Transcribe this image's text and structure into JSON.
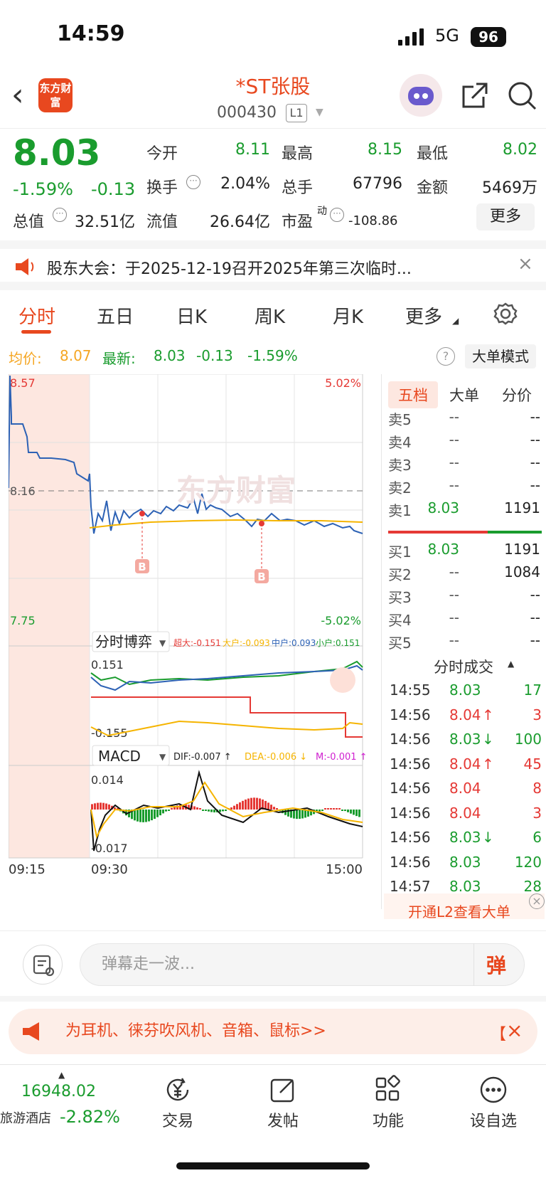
{
  "status": {
    "time": "14:59",
    "network": "5G",
    "battery": "96"
  },
  "header": {
    "title": "*ST张股",
    "code": "000430",
    "level": "L1",
    "logo": "东方财富"
  },
  "quote": {
    "price": "8.03",
    "change_pct": "-1.59%",
    "change": "-0.13",
    "open_label": "今开",
    "open": "8.11",
    "high_label": "最高",
    "high": "8.15",
    "low_label": "最低",
    "low": "8.02",
    "turnover_label": "换手",
    "turnover": "2.04%",
    "volume_label": "总手",
    "volume": "67796",
    "amount_label": "金额",
    "amount": "5469万",
    "mktcap_label": "总值",
    "mktcap": "32.51亿",
    "float_label": "流值",
    "float": "26.64亿",
    "pe_label": "市盈",
    "pe_sup": "动",
    "pe": "-108.86",
    "more": "更多"
  },
  "notice": {
    "text": "股东大会：于2025-12-19召开2025年第三次临时..."
  },
  "tabs": [
    "分时",
    "五日",
    "日K",
    "周K",
    "月K",
    "更多"
  ],
  "avgbar": {
    "avg_label": "均价:",
    "avg": "8.07",
    "latest_label": "最新:",
    "latest": "8.03",
    "chg": "-0.13",
    "pct": "-1.59%",
    "bigorder": "大单模式"
  },
  "chart_data": {
    "type": "line",
    "price_axis": {
      "max": "8.57",
      "ref": "8.16",
      "min": "7.75",
      "max_pct": "5.02%",
      "min_pct": "-5.02%"
    },
    "time_labels": [
      "09:15",
      "09:30",
      "15:00"
    ],
    "markers": [
      "B",
      "B"
    ],
    "sub1": {
      "name": "分时博弈",
      "legend": [
        {
          "label": "超大:-0.151",
          "color": "#e53935"
        },
        {
          "label": "大户:-0.093",
          "color": "#f5b400"
        },
        {
          "label": "中户:0.093",
          "color": "#2d62b5"
        },
        {
          "label": "小户:0.151",
          "color": "#1a9c2e"
        }
      ],
      "top": "0.151",
      "bottom": "-0.155"
    },
    "sub2": {
      "name": "MACD",
      "legend": [
        {
          "label": "DIF:-0.007 ↑",
          "color": "#222"
        },
        {
          "label": "DEA:-0.006 ↓",
          "color": "#f5b400"
        },
        {
          "label": "M:-0.001 ↑",
          "color": "#d020d0"
        }
      ],
      "top": "0.014",
      "bottom": "-0.017"
    }
  },
  "orderbook": {
    "tabs": [
      "五档",
      "大单",
      "分价"
    ],
    "asks": [
      {
        "label": "卖5",
        "price": "--",
        "vol": "--"
      },
      {
        "label": "卖4",
        "price": "--",
        "vol": "--"
      },
      {
        "label": "卖3",
        "price": "--",
        "vol": "--"
      },
      {
        "label": "卖2",
        "price": "--",
        "vol": "--"
      },
      {
        "label": "卖1",
        "price": "8.03",
        "vol": "1191"
      }
    ],
    "bids": [
      {
        "label": "买1",
        "price": "8.03",
        "vol": "1191"
      },
      {
        "label": "买2",
        "price": "--",
        "vol": "1084"
      },
      {
        "label": "买3",
        "price": "--",
        "vol": "--"
      },
      {
        "label": "买4",
        "price": "--",
        "vol": "--"
      },
      {
        "label": "买5",
        "price": "--",
        "vol": "--"
      }
    ],
    "trades_title": "分时成交",
    "trades": [
      {
        "time": "14:55",
        "price": "8.03",
        "arrow": "",
        "vol": "17",
        "vc": "green"
      },
      {
        "time": "14:56",
        "price": "8.04",
        "arrow": "↑",
        "vol": "3",
        "vc": "red"
      },
      {
        "time": "14:56",
        "price": "8.03",
        "arrow": "↓",
        "vol": "100",
        "vc": "green"
      },
      {
        "time": "14:56",
        "price": "8.04",
        "arrow": "↑",
        "vol": "45",
        "vc": "red"
      },
      {
        "time": "14:56",
        "price": "8.04",
        "arrow": "",
        "vol": "8",
        "vc": "red"
      },
      {
        "time": "14:56",
        "price": "8.04",
        "arrow": "",
        "vol": "3",
        "vc": "red"
      },
      {
        "time": "14:56",
        "price": "8.03",
        "arrow": "↓",
        "vol": "6",
        "vc": "green"
      },
      {
        "time": "14:56",
        "price": "8.03",
        "arrow": "",
        "vol": "120",
        "vc": "green"
      },
      {
        "time": "14:57",
        "price": "8.03",
        "arrow": "",
        "vol": "28",
        "vc": "green"
      }
    ],
    "l2": "开通L2查看大单"
  },
  "barrage": {
    "placeholder": "弹幕走一波...",
    "button": "弹"
  },
  "ad": {
    "text": "为耳机、徕芬吹风机、音箱、鼠标>>"
  },
  "bottom": {
    "index_value": "16948.02",
    "index_name": "旅游酒店",
    "index_pct": "-2.82%",
    "items": [
      "交易",
      "发帖",
      "功能",
      "设自选"
    ]
  }
}
